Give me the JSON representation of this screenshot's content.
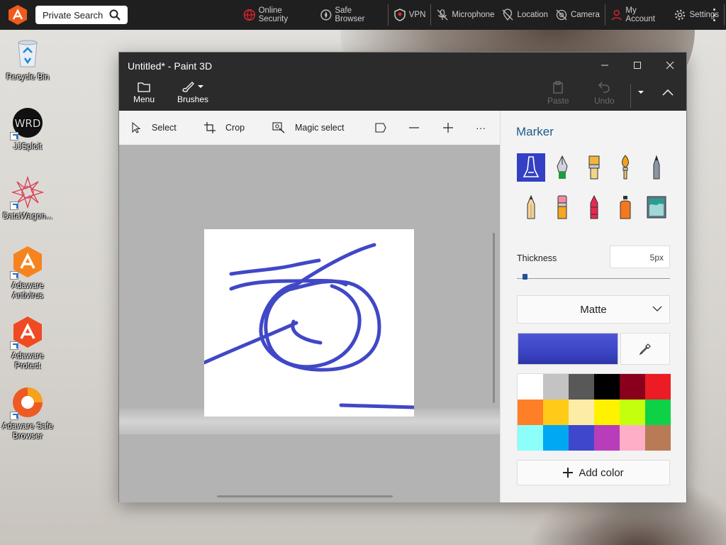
{
  "topbar": {
    "search_placeholder": "Private Search",
    "items": [
      {
        "label": "Online Security",
        "icon": "globe-shield-icon"
      },
      {
        "label": "Safe Browser",
        "icon": "compass-icon"
      },
      {
        "label": "VPN",
        "icon": "vpn-shield-icon"
      },
      {
        "label": "Microphone",
        "icon": "microphone-off-icon"
      },
      {
        "label": "Location",
        "icon": "location-off-icon"
      },
      {
        "label": "Camera",
        "icon": "camera-off-icon"
      },
      {
        "label": "My Account",
        "icon": "user-icon"
      },
      {
        "label": "Settings",
        "icon": "gear-icon"
      }
    ]
  },
  "desktop": {
    "icons": [
      {
        "label": "Recycle Bin"
      },
      {
        "label": "JJSploit"
      },
      {
        "label": "DataWagon..."
      },
      {
        "label": "Adaware Antivirus"
      },
      {
        "label": "Adaware Protect"
      },
      {
        "label": "Adaware Safe Browser"
      }
    ]
  },
  "window": {
    "title": "Untitled* - Paint 3D",
    "menu_label": "Menu",
    "brushes_label": "Brushes",
    "paste_label": "Paste",
    "undo_label": "Undo"
  },
  "toolbar": {
    "select_label": "Select",
    "crop_label": "Crop",
    "magic_select_label": "Magic select",
    "more_label": "···"
  },
  "panel": {
    "title": "Marker",
    "brushes": [
      "marker",
      "calligraphy-pen",
      "oil-brush",
      "watercolor",
      "pixel-pen",
      "pencil",
      "eraser",
      "crayon",
      "spray-can",
      "fill"
    ],
    "selected_brush": "marker",
    "thickness_label": "Thickness",
    "thickness_value": "5px",
    "finish": "Matte",
    "current_color": "#3f47cc",
    "palette": [
      "#ffffff",
      "#c3c3c3",
      "#585858",
      "#000000",
      "#88001b",
      "#ec1c24",
      "#ff7f27",
      "#ffca18",
      "#fdeca6",
      "#fff200",
      "#c4ff0e",
      "#0ed145",
      "#8cfffb",
      "#00a8f3",
      "#3f48cc",
      "#b83dba",
      "#ffaec8",
      "#b97a56"
    ],
    "add_color_label": "Add color"
  }
}
